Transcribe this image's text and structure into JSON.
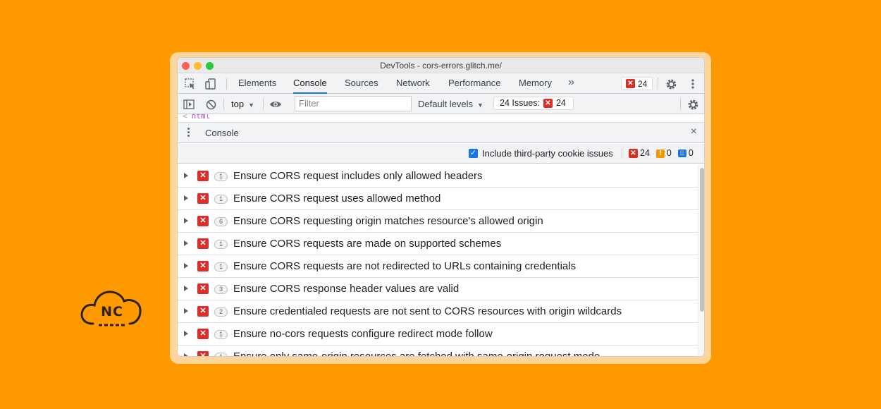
{
  "window": {
    "title": "DevTools - cors-errors.glitch.me/"
  },
  "tabs": {
    "items": [
      "Elements",
      "Console",
      "Sources",
      "Network",
      "Performance",
      "Memory"
    ],
    "active": "Console",
    "more": "»",
    "error_count": "24"
  },
  "toolbar": {
    "context": "top",
    "filter_placeholder": "Filter",
    "levels": "Default levels",
    "issues_label": "24 Issues:",
    "issues_count": "24"
  },
  "html_fragment": {
    "arrow": "<",
    "text": "html"
  },
  "drawer": {
    "title": "Console",
    "close": "×"
  },
  "issues_bar": {
    "checkbox_label": "Include third-party cookie issues",
    "checked": true,
    "error_count": "24",
    "warning_count": "0",
    "info_count": "0"
  },
  "issues": [
    {
      "count": "1",
      "title": "Ensure CORS request includes only allowed headers"
    },
    {
      "count": "1",
      "title": "Ensure CORS request uses allowed method"
    },
    {
      "count": "6",
      "title": "Ensure CORS requesting origin matches resource's allowed origin"
    },
    {
      "count": "1",
      "title": "Ensure CORS requests are made on supported schemes"
    },
    {
      "count": "1",
      "title": "Ensure CORS requests are not redirected to URLs containing credentials"
    },
    {
      "count": "3",
      "title": "Ensure CORS response header values are valid"
    },
    {
      "count": "2",
      "title": "Ensure credentialed requests are not sent to CORS resources with origin wildcards"
    },
    {
      "count": "1",
      "title": "Ensure no-cors requests configure redirect mode follow"
    },
    {
      "count": "1",
      "title": "Ensure only same-origin resources are fetched with same-origin request mode"
    }
  ],
  "logo": {
    "text": "NC"
  },
  "colors": {
    "background": "#ff9900",
    "accent": "#1a73e8",
    "error": "#d93025",
    "warning": "#f29900"
  }
}
